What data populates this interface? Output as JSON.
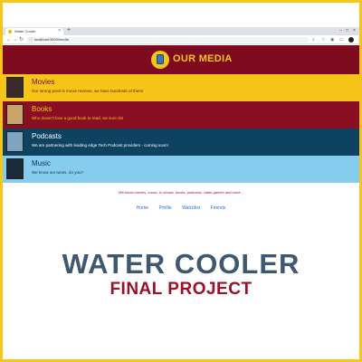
{
  "browser": {
    "tab_title": "Water Cooler",
    "tab_close": "×",
    "new_tab": "+",
    "url": "localhost:3000/media",
    "icons": [
      "back-icon",
      "forward-icon",
      "reload-icon",
      "info-icon",
      "zoom-icon",
      "star-icon",
      "extension-icon",
      "account-icon",
      "menu-icon"
    ]
  },
  "app": {
    "header_title": "OUR MEDIA",
    "brand_colors": {
      "maroon": "#7d0a1e",
      "gold": "#f5c518",
      "navy": "#0d4260",
      "sky": "#86ccef"
    },
    "cards": [
      {
        "title": "Movies",
        "description": "Our strong point is movie reviews, we have hundreds of them!"
      },
      {
        "title": "Books",
        "description": "Who doesn't love a good book to read, we sure do!"
      },
      {
        "title": "Podcasts",
        "description": "We are partnering with leading edge Tech Podcast providers - coming soon!"
      },
      {
        "title": "Music",
        "description": "We know our tunes, do you?"
      }
    ],
    "tagline": "We know movies, music, tv shows, books, podcasts, video games and more...",
    "footer_links": [
      "Home",
      "Profile",
      "Watchlist",
      "Friends"
    ]
  },
  "banner": {
    "title": "WATER COOLER",
    "subtitle": "FINAL PROJECT"
  }
}
